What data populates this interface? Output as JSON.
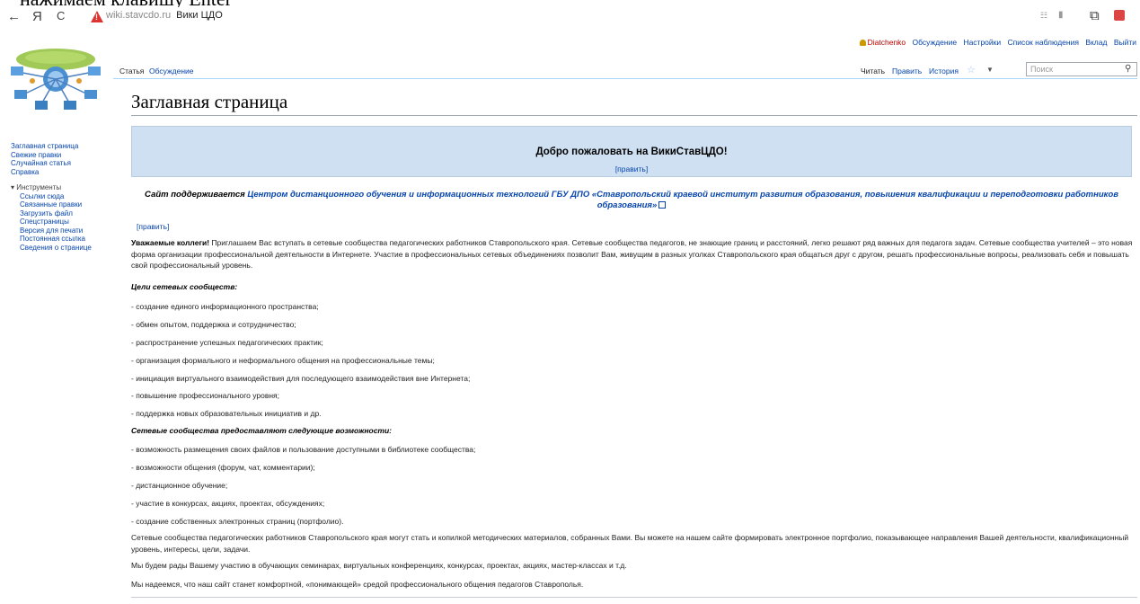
{
  "doc_top_text": "нажимаем клавишу Enter",
  "browser": {
    "back": "←",
    "yandex": "Я",
    "reload": "C",
    "domain": "wiki.stavcdo.ru",
    "tab_title": "Вики ЦДО"
  },
  "user_links": {
    "user": "Diatchenko",
    "items": [
      "Обсуждение",
      "Настройки",
      "Список наблюдения",
      "Вклад",
      "Выйти"
    ]
  },
  "tabs": {
    "article": "Статья",
    "discussion": "Обсуждение",
    "read": "Читать",
    "edit": "Править",
    "history": "История"
  },
  "search": {
    "placeholder": "Поиск"
  },
  "page_title": "Заглавная страница",
  "sidebar": {
    "nav": [
      "Заглавная страница",
      "Свежие правки",
      "Случайная статья",
      "Справка"
    ],
    "tools_label": "▾ Инструменты",
    "tools": [
      "Ссылки сюда",
      "Связанные правки",
      "Загрузить файл",
      "Спецстраницы",
      "Версия для печати",
      "Постоянная ссылка",
      "Сведения о странице"
    ]
  },
  "welcome": {
    "title": "Добро пожаловать на ВикиСтавЦДО!",
    "edit": "[править]"
  },
  "support": {
    "lead": "Сайт поддерживается ",
    "link": "Центром дистанционного обучения и информационных технологий ГБУ ДПО «Ставропольский краевой институт развития образования, повышения квалификации и переподготовки работников образования»"
  },
  "section_edit": "[править]",
  "intro": {
    "bold": "Уважаемые коллеги!",
    "text": " Приглашаем Вас вступать в сетевые сообщества педагогических работников Ставропольского края. Сетевые сообщества педагогов, не знающие границ и расстояний, легко решают ряд важных для педагога задач. Сетевые сообщества учителей – это новая форма организации профессиональной деятельности в Интернете. Участие в профессиональных сетевых объединениях позволит Вам, живущим в разных уголках Ставропольского края общаться друг с другом, решать профессиональные вопросы, реализовать себя и повышать свой профессиональный уровень."
  },
  "goals": {
    "heading": "Цели сетевых сообществ:",
    "items": [
      "- создание единого информационного пространства;",
      "- обмен опытом, поддержка и сотрудничество;",
      "- распространение успешных педагогических практик;",
      "- организация формального и неформального общения на профессиональные темы;",
      "- инициация виртуального взаимодействия для последующего взаимодействия вне Интернета;",
      "- повышение профессионального уровня;",
      "- поддержка новых образовательных инициатив и др."
    ]
  },
  "features": {
    "heading": "Сетевые сообщества предоставляют следующие возможности:",
    "items": [
      "- возможность размещения своих файлов и пользование доступными в библиотеке сообщества;",
      "- возможности общения (форум, чат, комментарии);",
      "- дистанционное обучение;",
      "- участие в конкурсах, акциях, проектах, обсуждениях;",
      "- создание собственных электронных страниц (портфолио)."
    ]
  },
  "portfolio_text": "Сетевые сообщества педагогических работников Ставропольского края могут стать и копилкой методических материалов, собранных Вами. Вы можете на нашем сайте формировать электронное портфолио, показывающее направления Вашей деятельности, квалификационный уровень, интересы, цели, задачи.",
  "glad": {
    "bold": "Мы будем рады",
    "text": " Вашему участию в обучающих семинарах, виртуальных конференциях, конкурсах, проектах, акциях, мастер-классах и т.д."
  },
  "hope": {
    "bold": "Мы надеемся,",
    "text": " что наш сайт станет комфортной, «понимающей» средой профессионального общения педагогов Ставрополья."
  }
}
